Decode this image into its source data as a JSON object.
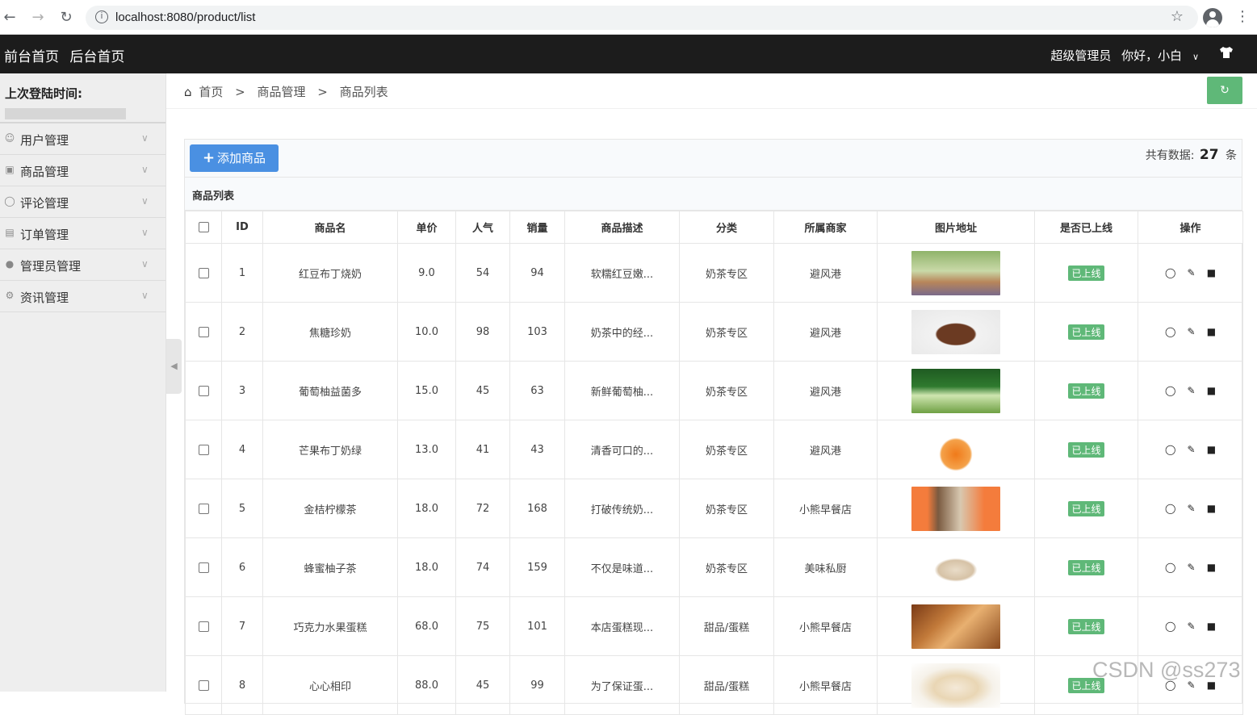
{
  "browser": {
    "url": "localhost:8080/product/list",
    "back_icon": "arrow-left-icon",
    "forward_icon": "arrow-right-icon",
    "reload_icon": "reload-icon"
  },
  "header": {
    "link_front": "前台首页",
    "link_back": "后台首页",
    "role": "超级管理员",
    "greeting": "你好，小白"
  },
  "sidebar": {
    "login_label": "上次登陆时间:",
    "items": [
      {
        "label": "用户管理",
        "icon": "user-icon"
      },
      {
        "label": "商品管理",
        "icon": "bag-icon"
      },
      {
        "label": "评论管理",
        "icon": "comment-icon"
      },
      {
        "label": "订单管理",
        "icon": "order-icon"
      },
      {
        "label": "管理员管理",
        "icon": "admin-icon"
      },
      {
        "label": "资讯管理",
        "icon": "gear-icon"
      }
    ]
  },
  "breadcrumb": {
    "home": "首页",
    "section": "商品管理",
    "page": "商品列表",
    "separator": ">"
  },
  "toolbar": {
    "add_label": "添加商品",
    "total_prefix": "共有数据:",
    "total_count": "27",
    "total_suffix": "条"
  },
  "list_title": "商品列表",
  "columns": [
    "ID",
    "商品名",
    "单价",
    "人气",
    "销量",
    "商品描述",
    "分类",
    "所属商家",
    "图片地址",
    "是否已上线",
    "操作"
  ],
  "rows": [
    {
      "id": "1",
      "name": "红豆布丁烧奶",
      "price": "9.0",
      "popularity": "54",
      "sales": "94",
      "desc": "软糯红豆嫩...",
      "category": "奶茶专区",
      "shop": "避风港",
      "status": "已上线",
      "thumb": "milk-tea-cup-image"
    },
    {
      "id": "2",
      "name": "焦糖珍奶",
      "price": "10.0",
      "popularity": "98",
      "sales": "103",
      "desc": "奶茶中的经...",
      "category": "奶茶专区",
      "shop": "避风港",
      "status": "已上线",
      "thumb": "caramel-drink-image"
    },
    {
      "id": "3",
      "name": "葡萄柚益菌多",
      "price": "15.0",
      "popularity": "45",
      "sales": "63",
      "desc": "新鲜葡萄柚...",
      "category": "奶茶专区",
      "shop": "避风港",
      "status": "已上线",
      "thumb": "green-drink-image"
    },
    {
      "id": "4",
      "name": "芒果布丁奶绿",
      "price": "13.0",
      "popularity": "41",
      "sales": "43",
      "desc": "清香可口的...",
      "category": "奶茶专区",
      "shop": "避风港",
      "status": "已上线",
      "thumb": "mango-drink-image"
    },
    {
      "id": "5",
      "name": "金桔柠檬茶",
      "price": "18.0",
      "popularity": "72",
      "sales": "168",
      "desc": "打破传统奶...",
      "category": "奶茶专区",
      "shop": "小熊早餐店",
      "status": "已上线",
      "thumb": "lemon-tea-image"
    },
    {
      "id": "6",
      "name": "蜂蜜柚子茶",
      "price": "18.0",
      "popularity": "74",
      "sales": "159",
      "desc": "不仅是味道...",
      "category": "奶茶专区",
      "shop": "美味私厨",
      "status": "已上线",
      "thumb": "honey-tea-image"
    },
    {
      "id": "7",
      "name": "巧克力水果蛋糕",
      "price": "68.0",
      "popularity": "75",
      "sales": "101",
      "desc": "本店蛋糕现...",
      "category": "甜品/蛋糕",
      "shop": "小熊早餐店",
      "status": "已上线",
      "thumb": "fruit-cake-image"
    },
    {
      "id": "8",
      "name": "心心相印",
      "price": "88.0",
      "popularity": "45",
      "sales": "99",
      "desc": "为了保证蛋...",
      "category": "甜品/蛋糕",
      "shop": "小熊早餐店",
      "status": "已上线",
      "thumb": "heart-cake-image"
    }
  ],
  "watermark": "CSDN @ss273"
}
